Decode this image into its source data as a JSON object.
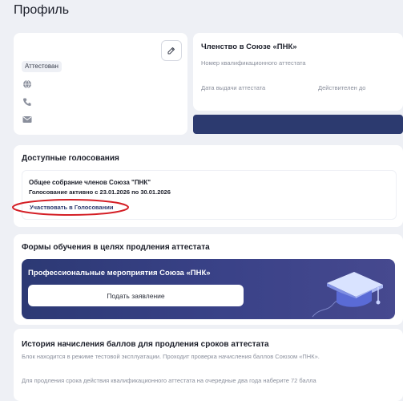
{
  "page": {
    "title": "Профиль"
  },
  "profile_card": {
    "status_badge": "Аттестован",
    "icons": [
      "globe-icon",
      "phone-icon",
      "mail-icon"
    ]
  },
  "membership": {
    "title": "Членство в Союзе «ПНК»",
    "cert_number_label": "Номер квалификационного аттестата",
    "issue_date_label": "Дата выдачи аттестата",
    "valid_until_label": "Действителен до"
  },
  "voting": {
    "title": "Доступные голосования",
    "item_title": "Общее собрание членов Союза \"ПНК\"",
    "item_status": "Голосование активно с 23.01.2026 по 30.01.2026",
    "participate_link": "Участвовать в Голосовании"
  },
  "training": {
    "title": "Формы обучения в целях продления аттестата",
    "banner_title": "Профессиональные мероприятия Союза «ПНК»",
    "apply_button": "Подать заявление"
  },
  "history": {
    "title": "История начисления баллов для продления сроков аттестата",
    "note": "Блок находится в режиме тестовой эксплуатации. Проходит проверка начисления баллов Союзом «ПНК».",
    "requirement": "Для продления срока действия квалификационного аттестата на очередные два года наберите 72 балла"
  },
  "colors": {
    "accent": "#2c3a6f",
    "highlight_ring": "#d41f26",
    "background": "#eef0f5"
  }
}
